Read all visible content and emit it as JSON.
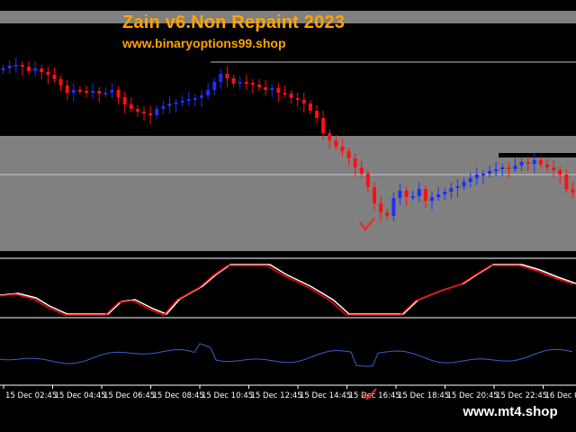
{
  "header": {
    "title": "Zain v6.Non Repaint 2023",
    "subtitle": "www.binaryoptions99.shop"
  },
  "footer": {
    "site": "www.mt4.shop"
  },
  "colors": {
    "background": "#000000",
    "band": "#808080",
    "bull_candle": "#1f2fff",
    "bear_candle": "#ff1010",
    "title_text": "#ffa500",
    "oscillator_line": "#ffffff",
    "oscillator_signal": "#ff0000",
    "oscillator_signal_alt": "#2040ff",
    "cci_line": "#3a5fcd",
    "check_mark": "#ff2020"
  },
  "icons": {
    "signal": "check-mark-icon"
  },
  "chart_data": {
    "type": "candlestick",
    "x_ticks": [
      "15 Dec 02:45",
      "15 Dec 04:45",
      "15 Dec 06:45",
      "15 Dec 08:45",
      "15 Dec 10:45",
      "15 Dec 12:45",
      "15 Dec 14:45",
      "15 Dec 16:45",
      "15 Dec 18:45",
      "15 Dec 20:45",
      "15 Dec 22:45",
      "16 Dec 0"
    ],
    "candles_closes": [
      76,
      73,
      72,
      74,
      79,
      76,
      80,
      83,
      88,
      95,
      103,
      100,
      101,
      102,
      101,
      104,
      103,
      100,
      108,
      116,
      121,
      124,
      126,
      128,
      121,
      118,
      115,
      114,
      112,
      110,
      109,
      106,
      100,
      91,
      82,
      87,
      93,
      91,
      92,
      94,
      97,
      100,
      98,
      103,
      104,
      109,
      111,
      115,
      123,
      131,
      148,
      156,
      163,
      168,
      176,
      186,
      193,
      208,
      226,
      236,
      240,
      220,
      212,
      219,
      218,
      210,
      223,
      219,
      216,
      213,
      209,
      207,
      202,
      198,
      194,
      193,
      190,
      188,
      186,
      188,
      184,
      180,
      182,
      178,
      183,
      186,
      189,
      194,
      210,
      214
    ],
    "oscillator": {
      "levels": [
        0,
        100
      ],
      "signal_alert": "check-mark-icon"
    }
  }
}
